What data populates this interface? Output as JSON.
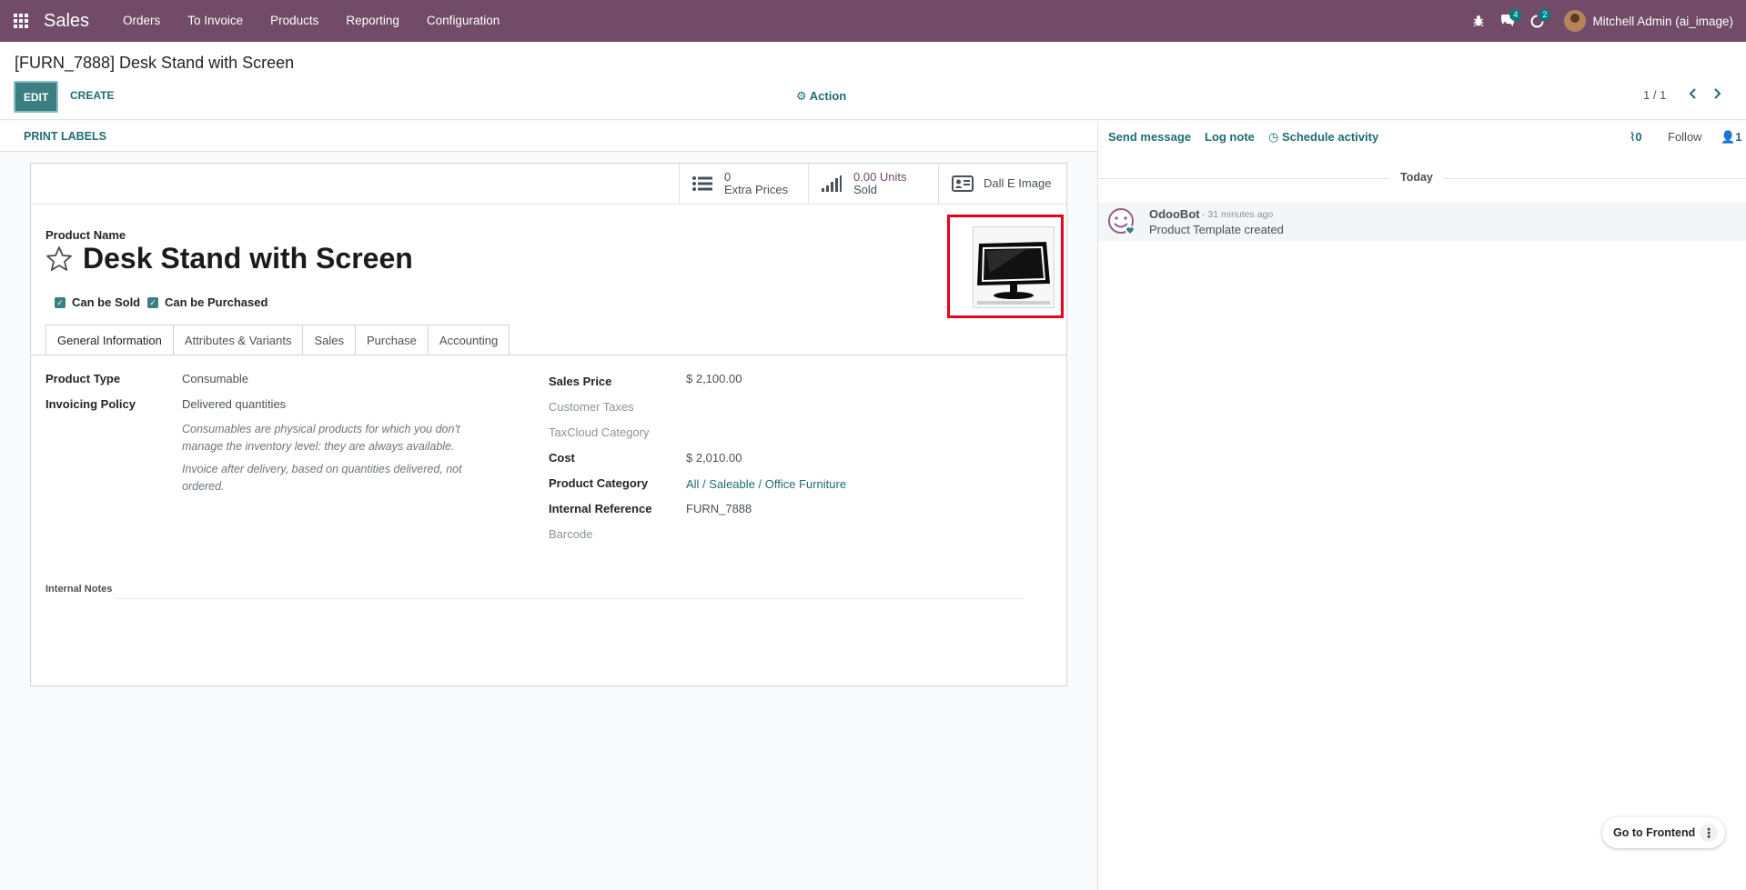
{
  "navbar": {
    "app_name": "Sales",
    "menu": [
      "Orders",
      "To Invoice",
      "Products",
      "Reporting",
      "Configuration"
    ],
    "messages_count": "4",
    "activities_count": "2",
    "user": "Mitchell Admin (ai_image)"
  },
  "control": {
    "breadcrumb": "[FURN_7888] Desk Stand with Screen",
    "edit_label": "EDIT",
    "create_label": "CREATE",
    "action_label": "Action",
    "pager": "1 / 1"
  },
  "statusbar": {
    "print_labels": "PRINT LABELS"
  },
  "stats": {
    "extra_prices_value": "0",
    "extra_prices_label": "Extra Prices",
    "sold_value": "0.00 Units",
    "sold_label": "Sold",
    "dalle_label": "Dall E Image"
  },
  "product": {
    "name_label": "Product Name",
    "name": "Desk Stand with Screen",
    "can_be_sold": "Can be Sold",
    "can_be_purchased": "Can be Purchased"
  },
  "tabs": [
    "General Information",
    "Attributes & Variants",
    "Sales",
    "Purchase",
    "Accounting"
  ],
  "general": {
    "product_type_label": "Product Type",
    "product_type": "Consumable",
    "invoicing_label": "Invoicing Policy",
    "invoicing": "Delivered quantities",
    "help1": "Consumables are physical products for which you don't manage the inventory level: they are always available.",
    "help2": "Invoice after delivery, based on quantities delivered, not ordered.",
    "sales_price_label": "Sales Price",
    "sales_price": "$ 2,100.00",
    "customer_taxes_label": "Customer Taxes",
    "taxcloud_label": "TaxCloud Category",
    "cost_label": "Cost",
    "cost": "$ 2,010.00",
    "category_label": "Product Category",
    "category": "All / Saleable / Office Furniture",
    "internal_ref_label": "Internal Reference",
    "internal_ref": "FURN_7888",
    "barcode_label": "Barcode",
    "internal_notes_label": "Internal Notes"
  },
  "chatter": {
    "send_message": "Send message",
    "log_note": "Log note",
    "schedule_activity": "Schedule activity",
    "attachments": "0",
    "follow": "Follow",
    "followers": "1",
    "today": "Today",
    "author": "OdooBot",
    "time": "- 31 minutes ago",
    "body": "Product Template created"
  },
  "frontend_label": "Go to Frontend",
  "colors": {
    "brand": "#714b67",
    "accent": "#1f6d71",
    "highlight": "#e8001c"
  }
}
